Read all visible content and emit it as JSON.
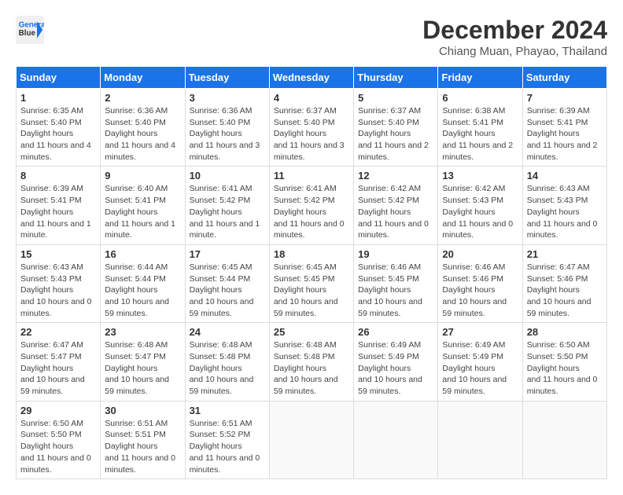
{
  "header": {
    "logo_line1": "General",
    "logo_line2": "Blue",
    "month": "December 2024",
    "location": "Chiang Muan, Phayao, Thailand"
  },
  "weekdays": [
    "Sunday",
    "Monday",
    "Tuesday",
    "Wednesday",
    "Thursday",
    "Friday",
    "Saturday"
  ],
  "weeks": [
    [
      {
        "day": "1",
        "sunrise": "6:35 AM",
        "sunset": "5:40 PM",
        "daylight": "11 hours and 4 minutes."
      },
      {
        "day": "2",
        "sunrise": "6:36 AM",
        "sunset": "5:40 PM",
        "daylight": "11 hours and 4 minutes."
      },
      {
        "day": "3",
        "sunrise": "6:36 AM",
        "sunset": "5:40 PM",
        "daylight": "11 hours and 3 minutes."
      },
      {
        "day": "4",
        "sunrise": "6:37 AM",
        "sunset": "5:40 PM",
        "daylight": "11 hours and 3 minutes."
      },
      {
        "day": "5",
        "sunrise": "6:37 AM",
        "sunset": "5:40 PM",
        "daylight": "11 hours and 2 minutes."
      },
      {
        "day": "6",
        "sunrise": "6:38 AM",
        "sunset": "5:41 PM",
        "daylight": "11 hours and 2 minutes."
      },
      {
        "day": "7",
        "sunrise": "6:39 AM",
        "sunset": "5:41 PM",
        "daylight": "11 hours and 2 minutes."
      }
    ],
    [
      {
        "day": "8",
        "sunrise": "6:39 AM",
        "sunset": "5:41 PM",
        "daylight": "11 hours and 1 minute."
      },
      {
        "day": "9",
        "sunrise": "6:40 AM",
        "sunset": "5:41 PM",
        "daylight": "11 hours and 1 minute."
      },
      {
        "day": "10",
        "sunrise": "6:41 AM",
        "sunset": "5:42 PM",
        "daylight": "11 hours and 1 minute."
      },
      {
        "day": "11",
        "sunrise": "6:41 AM",
        "sunset": "5:42 PM",
        "daylight": "11 hours and 0 minutes."
      },
      {
        "day": "12",
        "sunrise": "6:42 AM",
        "sunset": "5:42 PM",
        "daylight": "11 hours and 0 minutes."
      },
      {
        "day": "13",
        "sunrise": "6:42 AM",
        "sunset": "5:43 PM",
        "daylight": "11 hours and 0 minutes."
      },
      {
        "day": "14",
        "sunrise": "6:43 AM",
        "sunset": "5:43 PM",
        "daylight": "11 hours and 0 minutes."
      }
    ],
    [
      {
        "day": "15",
        "sunrise": "6:43 AM",
        "sunset": "5:43 PM",
        "daylight": "10 hours and 0 minutes."
      },
      {
        "day": "16",
        "sunrise": "6:44 AM",
        "sunset": "5:44 PM",
        "daylight": "10 hours and 59 minutes."
      },
      {
        "day": "17",
        "sunrise": "6:45 AM",
        "sunset": "5:44 PM",
        "daylight": "10 hours and 59 minutes."
      },
      {
        "day": "18",
        "sunrise": "6:45 AM",
        "sunset": "5:45 PM",
        "daylight": "10 hours and 59 minutes."
      },
      {
        "day": "19",
        "sunrise": "6:46 AM",
        "sunset": "5:45 PM",
        "daylight": "10 hours and 59 minutes."
      },
      {
        "day": "20",
        "sunrise": "6:46 AM",
        "sunset": "5:46 PM",
        "daylight": "10 hours and 59 minutes."
      },
      {
        "day": "21",
        "sunrise": "6:47 AM",
        "sunset": "5:46 PM",
        "daylight": "10 hours and 59 minutes."
      }
    ],
    [
      {
        "day": "22",
        "sunrise": "6:47 AM",
        "sunset": "5:47 PM",
        "daylight": "10 hours and 59 minutes."
      },
      {
        "day": "23",
        "sunrise": "6:48 AM",
        "sunset": "5:47 PM",
        "daylight": "10 hours and 59 minutes."
      },
      {
        "day": "24",
        "sunrise": "6:48 AM",
        "sunset": "5:48 PM",
        "daylight": "10 hours and 59 minutes."
      },
      {
        "day": "25",
        "sunrise": "6:48 AM",
        "sunset": "5:48 PM",
        "daylight": "10 hours and 59 minutes."
      },
      {
        "day": "26",
        "sunrise": "6:49 AM",
        "sunset": "5:49 PM",
        "daylight": "10 hours and 59 minutes."
      },
      {
        "day": "27",
        "sunrise": "6:49 AM",
        "sunset": "5:49 PM",
        "daylight": "10 hours and 59 minutes."
      },
      {
        "day": "28",
        "sunrise": "6:50 AM",
        "sunset": "5:50 PM",
        "daylight": "11 hours and 0 minutes."
      }
    ],
    [
      {
        "day": "29",
        "sunrise": "6:50 AM",
        "sunset": "5:50 PM",
        "daylight": "11 hours and 0 minutes."
      },
      {
        "day": "30",
        "sunrise": "6:51 AM",
        "sunset": "5:51 PM",
        "daylight": "11 hours and 0 minutes."
      },
      {
        "day": "31",
        "sunrise": "6:51 AM",
        "sunset": "5:52 PM",
        "daylight": "11 hours and 0 minutes."
      },
      null,
      null,
      null,
      null
    ]
  ]
}
